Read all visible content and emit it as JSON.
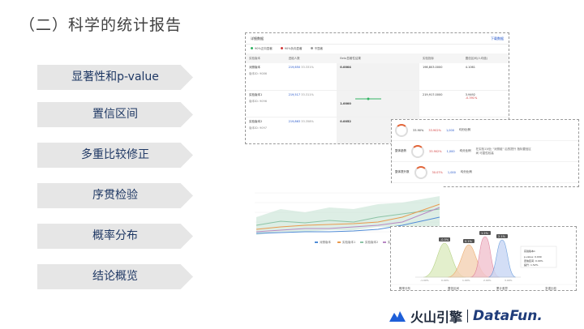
{
  "title": "（二）科学的统计报告",
  "menu": [
    {
      "label": "显著性和p-value"
    },
    {
      "label": "置信区间"
    },
    {
      "label": "多重比较修正"
    },
    {
      "label": "序贯检验"
    },
    {
      "label": "概率分布"
    },
    {
      "label": "结论概览"
    }
  ],
  "report": {
    "header": "详细数据",
    "download": "下载数据",
    "legend": [
      "90%正向显著",
      "90%负向显著",
      "不显著"
    ],
    "columns": [
      "实验版本",
      "进组人数",
      "Beta显著性结果",
      "实验指标",
      "置信区间(人均值)"
    ],
    "rows": [
      {
        "name": "对照版本",
        "id": "版本ID: 9086",
        "users": "219,650",
        "pct": "33.331%",
        "sig": "0.0004",
        "metric": "198,803.0000",
        "ci": "4.1061"
      },
      {
        "name": "实验版本1",
        "id": "版本ID: 9096",
        "users": "219,517",
        "pct": "33.311%",
        "sig": "1.0000",
        "metric": "219,917.0000",
        "ci": "3.9492"
      },
      {
        "name": "实验版本2",
        "id": "版本ID: 9097",
        "users": "219,863",
        "pct": "33.358%",
        "sig": "0.0052",
        "metric": "",
        "ci": ""
      }
    ],
    "sig_tag": "显著",
    "ci_labels": [
      "-0.04%",
      "+0.16%",
      "-0.80%",
      "+2.25%"
    ],
    "ci_pct": "-0.391%"
  },
  "conclusion": {
    "rows": [
      {
        "ring": "33.90%",
        "a": "33.902%",
        "b": "1,000",
        "c": "均分比例"
      },
      {
        "ring": "33.90%",
        "label": "整体趋势",
        "a": "33.902%",
        "b": "1,000",
        "c": "均分比例",
        "note": "在实验1对比 \"对照组\" 后的提升 指标置信区间 可靠性较高"
      },
      {
        "ring": "30.07%",
        "label": "整体提升数",
        "a": "30.07%",
        "b": "1,000",
        "c": "均分比例"
      }
    ]
  },
  "trend": {
    "legend": [
      "对照版本",
      "实验版本1",
      "实验版本2",
      "实验版本3"
    ],
    "colors": [
      "#4f8bd6",
      "#e99a4e",
      "#8cc3a6",
      "#b788c3"
    ]
  },
  "distribution": {
    "peak_labels": [
      "-0.5%",
      "0.1%",
      "1.2%",
      "2.1%"
    ],
    "axis": [
      "-1.00%",
      "0.00%",
      "1.00%",
      "2.00%",
      "3.00%"
    ],
    "tooltip": {
      "title": "实验版本1",
      "rows": [
        "p-value: 0.009",
        "置信区间: 0.00%",
        "提升: 1.52%"
      ]
    },
    "tabs": [
      "概率分布",
      "置信区间",
      "累计差异",
      "多重比较"
    ]
  },
  "logos": {
    "cn": "火山引擎",
    "df": "DataFun."
  }
}
